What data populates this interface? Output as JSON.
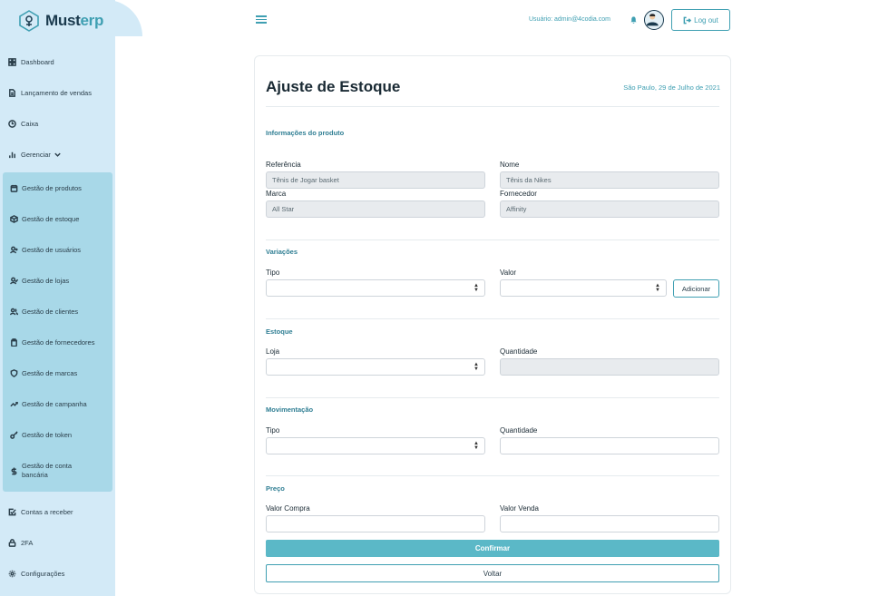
{
  "brand": {
    "name_main": "Must",
    "name_accent": "erp"
  },
  "sidebar": {
    "items_top": [
      {
        "label": "Dashboard",
        "icon": "grid-icon"
      },
      {
        "label": "Lançamento de vendas",
        "icon": "document-icon"
      },
      {
        "label": "Caixa",
        "icon": "clock-icon"
      },
      {
        "label": "Gerenciar",
        "icon": "bar-chart-icon"
      }
    ],
    "submenu": [
      {
        "label": "Gestão de produtos",
        "icon": "calendar-icon"
      },
      {
        "label": "Gestão de estoque",
        "icon": "box-icon"
      },
      {
        "label": "Gestão de usuários",
        "icon": "user-add-icon"
      },
      {
        "label": "Gestão de lojas",
        "icon": "user-check-icon"
      },
      {
        "label": "Gestão de clientes",
        "icon": "users-icon"
      },
      {
        "label": "Gestão de fornecedores",
        "icon": "clipboard-icon"
      },
      {
        "label": "Gestão de marcas",
        "icon": "shield-icon"
      },
      {
        "label": "Gestão de campanha",
        "icon": "trending-icon"
      },
      {
        "label": "Gestão de token",
        "icon": "key-icon"
      },
      {
        "label": "Gestão de conta bancária",
        "label_line1": "Gestão de conta",
        "label_line2": "bancária",
        "icon": "dollar-icon"
      }
    ],
    "items_bottom": [
      {
        "label": "Contas a receber",
        "icon": "check-square-icon"
      },
      {
        "label": "2FA",
        "icon": "lock-icon"
      },
      {
        "label": "Configurações",
        "icon": "gear-icon"
      }
    ]
  },
  "header": {
    "user_label": "Usuário: admin@4codia.com",
    "logout_label": "Log out"
  },
  "page": {
    "title": "Ajuste de Estoque",
    "date": "São Paulo, 29 de Julho de 2021"
  },
  "sections": {
    "produto": {
      "title": "Informações do produto",
      "referencia_label": "Referência",
      "referencia_value": "Tênis de Jogar basket",
      "nome_label": "Nome",
      "nome_value": "Tênis da Nikes",
      "marca_label": "Marca",
      "marca_value": "All Star",
      "fornecedor_label": "Fornecedor",
      "fornecedor_value": "Affinity"
    },
    "variacoes": {
      "title": "Variações",
      "tipo_label": "Tipo",
      "valor_label": "Valor",
      "add_label": "Adicionar"
    },
    "estoque": {
      "title": "Estoque",
      "loja_label": "Loja",
      "quantidade_label": "Quantidade"
    },
    "movimentacao": {
      "title": "Movimentação",
      "tipo_label": "Tipo",
      "quantidade_label": "Quantidade"
    },
    "preco": {
      "title": "Preço",
      "compra_label": "Valor Compra",
      "venda_label": "Valor Venda"
    }
  },
  "actions": {
    "confirm_label": "Confirmar",
    "back_label": "Voltar"
  },
  "colors": {
    "accent": "#3f9fb2",
    "sidebar": "#d3eaf7",
    "submenu": "#a8d8e8",
    "confirm": "#5bb8c7"
  }
}
